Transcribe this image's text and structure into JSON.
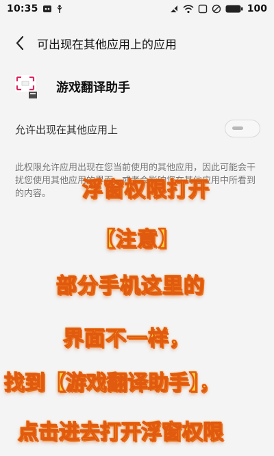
{
  "status_bar": {
    "time": "10:35",
    "battery": "100"
  },
  "header": {
    "title": "可出现在其他应用上的应用"
  },
  "app": {
    "name": "游戏翻译助手"
  },
  "permission": {
    "label": "允许出现在其他应用上",
    "enabled": false,
    "description": "此权限允许应用出现在您当前使用的其他应用，因此可能会干扰您使用其他应用的界面，或者会影响您在其他应用中所看到的内容。"
  },
  "overlay": {
    "line1": "浮窗权限打开",
    "line2": "【注意】",
    "line3": "部分手机这里的",
    "line4": "界面不一样，",
    "line5": "找到【游戏翻译助手】，",
    "line6": "点击进去打开浮窗权限"
  },
  "colors": {
    "background": "#f4f4f4",
    "annotation_fill": "#ffd23a",
    "annotation_stroke": "#e05a10"
  }
}
